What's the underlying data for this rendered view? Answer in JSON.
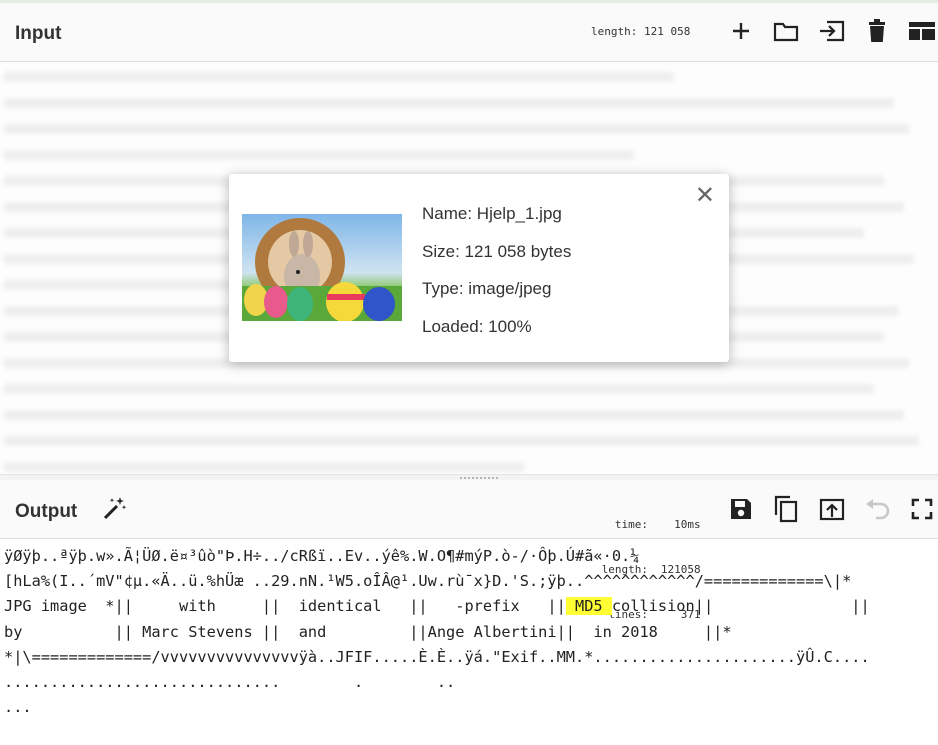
{
  "input": {
    "title": "Input",
    "length_label": "length:",
    "length_value": "121 058",
    "icons": [
      "plus-icon",
      "folder-icon",
      "import-icon",
      "trash-icon",
      "layout-icon"
    ]
  },
  "file_details": {
    "name": "Name: Hjelp_1.jpg",
    "size": "Size: 121 058 bytes",
    "type": "Type: image/jpeg",
    "loaded": "Loaded: 100%",
    "close": "✕"
  },
  "output": {
    "title": "Output",
    "stats": {
      "time_label": "time:",
      "time_value": "10ms",
      "length_label": "length:",
      "length_value": "121058",
      "lines_label": "lines:",
      "lines_value": "371"
    },
    "lines": [
      "ÿØÿþ..ªÿþ.w».Ã¦ÜØ.ë¤³ûò\"Þ.H÷../cRßï..Ev..ýê%.W.O¶#mýP.ò-/·Ôþ.Ú#ã«·0.¼",
      "[hLa%(I..´mV\"¢µ.«Ä..ü.%hÜæ ..29.nN.¹W5.oÎÂ@¹.Uw.rù¯x}D.'S.;ÿþ..^^^^^^^^^^^^/=============\\|*",
      "JPG image  *||     with     ||  identical   ||   -prefix   ||",
      " MD5 ",
      "collision||               ||",
      "by          || Marc Stevens ||  and         ||Ange Albertini||  in 2018     ||*",
      "*|\\=============/vvvvvvvvvvvvvvvÿà..JFIF.....È.È..ÿá.\"Exif..MM.*......................ÿÛ.C....",
      "..............................        .        ..",
      "..."
    ]
  },
  "colors": {
    "highlight": "#ffff33",
    "header_bg": "#fafafa"
  }
}
